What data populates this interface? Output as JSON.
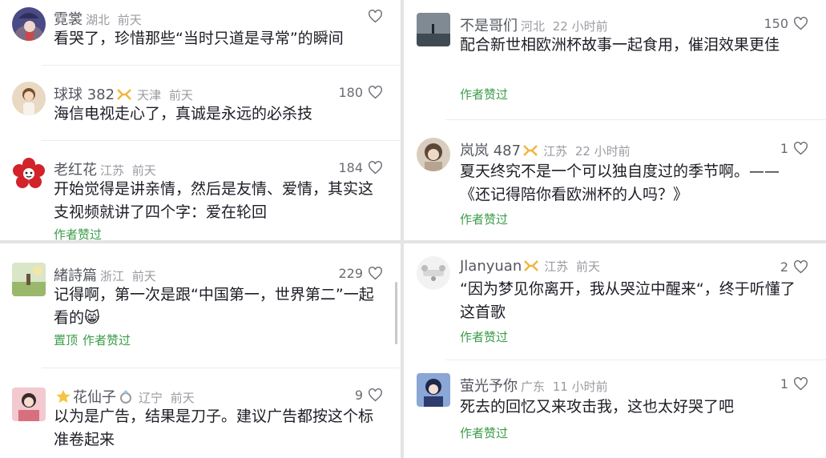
{
  "comments": [
    {
      "name": "霓裳",
      "location": "湖北",
      "time": "前天",
      "likes": "",
      "text": "看哭了，珍惜那些“当时只道是寻常”的瞬间",
      "tags": []
    },
    {
      "name": "球球 382",
      "location": "天津",
      "time": "前天",
      "likes": "180",
      "text": "海信电视走心了，真诚是永远的必杀技",
      "tags": []
    },
    {
      "name": "老红花",
      "location": "江苏",
      "time": "前天",
      "likes": "184",
      "text": "开始觉得是讲亲情，然后是友情、爱情，其实这支视频就讲了四个字：爱在轮回",
      "tags": [
        "作者赞过"
      ]
    },
    {
      "name": "緒詩篇",
      "location": "浙江",
      "time": "前天",
      "likes": "229",
      "text": "记得啊，第一次是跟“中国第一，世界第二”一起看的",
      "emoji": "😸",
      "tags": [
        "置顶",
        "作者赞过"
      ]
    },
    {
      "name": "花仙子",
      "location": "辽宁",
      "time": "前天",
      "likes": "9",
      "text": "以为是广告，结果是刀子。建议广告都按这个标准卷起来",
      "tags": []
    },
    {
      "name": "不是哥们",
      "location": "河北",
      "time": "22 小时前",
      "likes": "150",
      "text": "配合新世相欧洲杯故事一起食用，催泪效果更佳",
      "tags": [
        "作者赞过"
      ]
    },
    {
      "name": "岚岚 487",
      "location": "江苏",
      "time": "22 小时前",
      "likes": "1",
      "text": "夏天终究不是一个可以独自度过的季节啊。——《还记得陪你看欧洲杯的人吗？》",
      "tags": [
        "作者赞过"
      ]
    },
    {
      "name": "Jlanyuan",
      "location": "江苏",
      "time": "前天",
      "likes": "2",
      "text": "“因为梦见你离开，我从哭泣中醒来“，终于听懂了这首歌",
      "tags": [
        "作者赞过"
      ]
    },
    {
      "name": "萤光予你",
      "location": "广东",
      "time": "11 小时前",
      "likes": "1",
      "text": "死去的回忆又来攻击我，这也太好哭了吧",
      "tags": [
        "作者赞过"
      ]
    }
  ],
  "colors": {
    "accent_green": "#3c9c4a",
    "badge_gold": "#f2b43d",
    "meta_gray": "#9a9ba1"
  }
}
